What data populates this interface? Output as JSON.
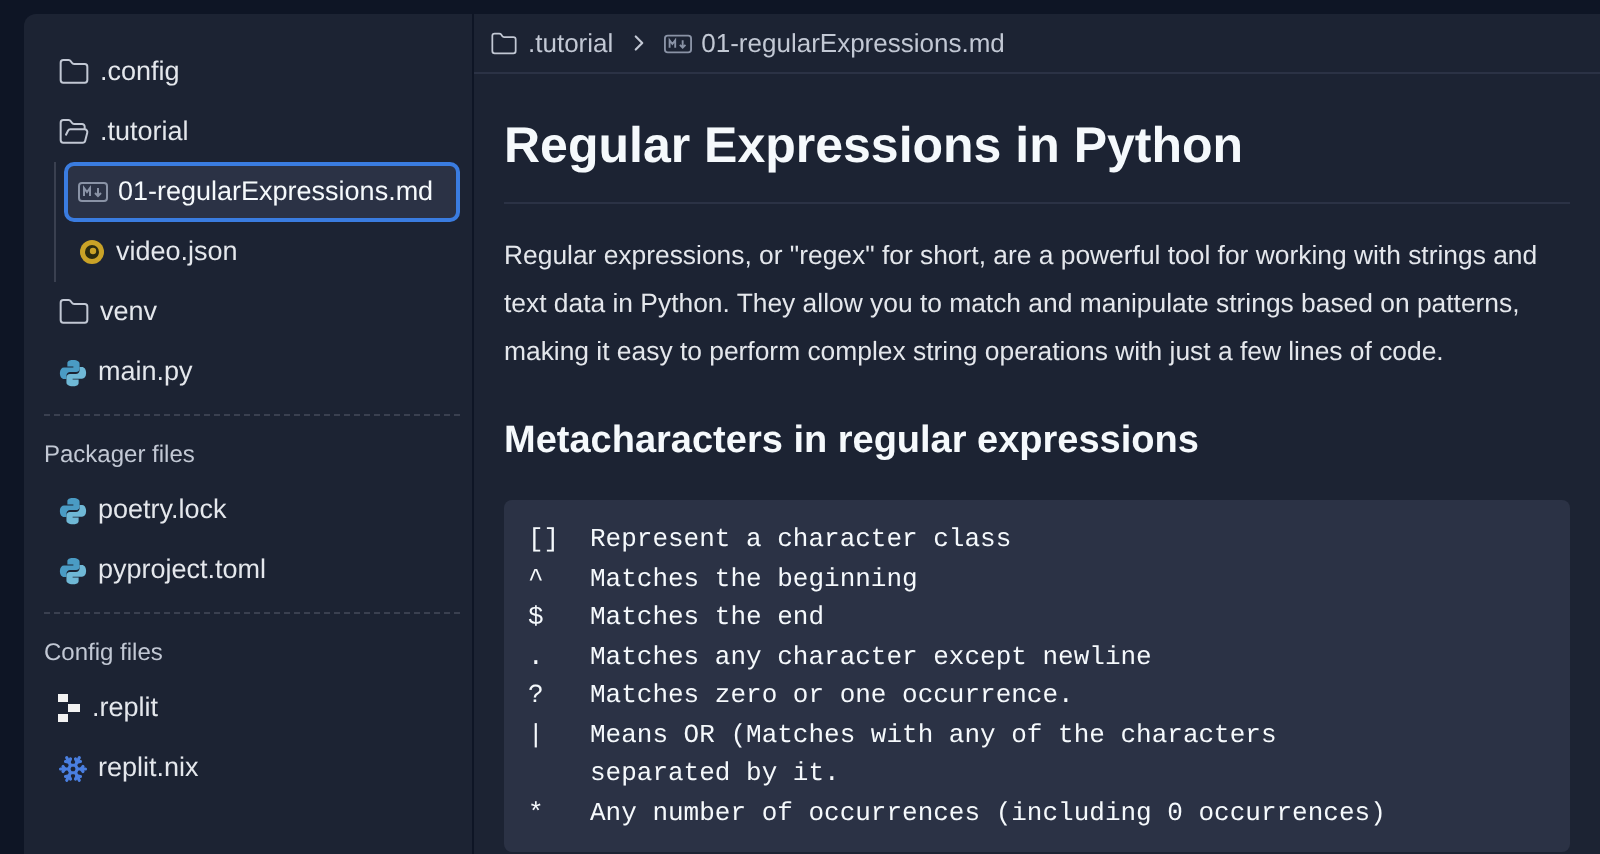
{
  "sidebar": {
    "sections": [
      {
        "items": [
          {
            "name": ".config",
            "kind": "folder",
            "expanded": false,
            "selected": false
          },
          {
            "name": ".tutorial",
            "kind": "folder",
            "expanded": true,
            "selected": false,
            "children": [
              {
                "name": "01-regularExpressions.md",
                "kind": "markdown",
                "selected": true
              },
              {
                "name": "video.json",
                "kind": "json",
                "selected": false
              }
            ]
          },
          {
            "name": "venv",
            "kind": "folder",
            "expanded": false,
            "selected": false
          },
          {
            "name": "main.py",
            "kind": "python",
            "selected": false
          }
        ]
      },
      {
        "title": "Packager files",
        "items": [
          {
            "name": "poetry.lock",
            "kind": "python",
            "selected": false
          },
          {
            "name": "pyproject.toml",
            "kind": "python",
            "selected": false
          }
        ]
      },
      {
        "title": "Config files",
        "items": [
          {
            "name": ".replit",
            "kind": "replit",
            "selected": false
          },
          {
            "name": "replit.nix",
            "kind": "nix",
            "selected": false
          }
        ]
      }
    ]
  },
  "breadcrumb": [
    {
      "name": ".tutorial",
      "kind": "folder"
    },
    {
      "name": "01-regularExpressions.md",
      "kind": "markdown"
    }
  ],
  "document": {
    "title": "Regular Expressions in Python",
    "intro": "Regular expressions, or \"regex\" for short, are a powerful tool for working with strings and text data in Python. They allow you to match and manipulate strings based on patterns, making it easy to perform complex string operations with just a few lines of code.",
    "heading": "Metacharacters in regular expressions",
    "code": [
      {
        "symbol": "[]",
        "lines": [
          "Represent a character class"
        ]
      },
      {
        "symbol": "^",
        "lines": [
          "Matches the beginning"
        ]
      },
      {
        "symbol": "$",
        "lines": [
          "Matches the end"
        ]
      },
      {
        "symbol": ".",
        "lines": [
          "Matches any character except newline"
        ]
      },
      {
        "symbol": "?",
        "lines": [
          "Matches zero or one occurrence."
        ]
      },
      {
        "symbol": "|",
        "lines": [
          "Means OR (Matches with any of the characters",
          "separated by it."
        ]
      },
      {
        "symbol": "*",
        "lines": [
          "Any number of occurrences (including 0 occurrences)"
        ]
      }
    ]
  }
}
